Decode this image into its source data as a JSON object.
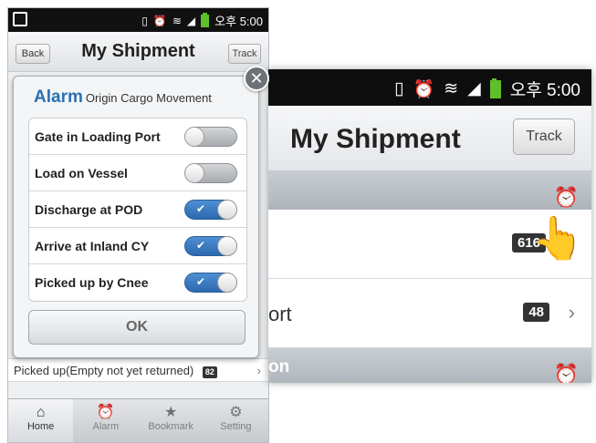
{
  "status_bar": {
    "time": "오후 5:00"
  },
  "header": {
    "back_label": "Back",
    "title": "My Shipment",
    "track_label": "Track"
  },
  "alarm_dialog": {
    "title_big": "Alarm",
    "title_small": "Origin Cargo Movement",
    "options": [
      {
        "label": "Gate in Loading Port",
        "on": false
      },
      {
        "label": "Load on Vessel",
        "on": false
      },
      {
        "label": "Discharge at POD",
        "on": true
      },
      {
        "label": "Arrive at Inland CY",
        "on": true
      },
      {
        "label": "Picked up by Cnee",
        "on": true
      }
    ],
    "ok_label": "OK"
  },
  "background_list": {
    "picked_row_label": "Picked up(Empty not yet returned)",
    "picked_row_count": "82"
  },
  "tabs": [
    {
      "label": "Home",
      "icon": "home-icon",
      "active": true
    },
    {
      "label": "Alarm",
      "icon": "alarm-clock-icon",
      "active": false
    },
    {
      "label": "Bookmark",
      "icon": "star-icon",
      "active": false
    },
    {
      "label": "Setting",
      "icon": "gear-icon",
      "active": false
    }
  ],
  "zoom": {
    "time": "오후 5:00",
    "title": "My Shipment",
    "track_label": "Track",
    "row1_count": "616",
    "row2_label_fragment": "ort",
    "row2_count": "48",
    "section2_label_fragment": "on"
  },
  "colors": {
    "accent": "#2b6fb3",
    "toggle_on": "#3a7cc2",
    "section_bar": "#b7bcc2"
  }
}
